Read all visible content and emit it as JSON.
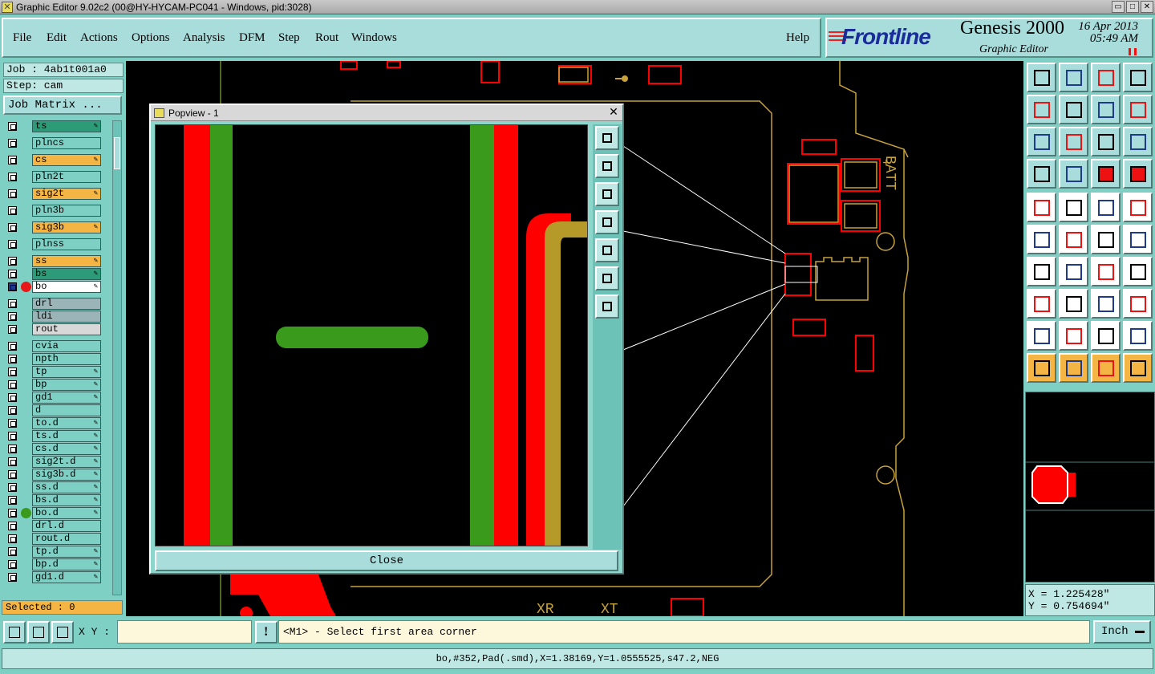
{
  "window": {
    "title": "Graphic Editor 9.02c2 (00@HY-HYCAM-PC041 - Windows, pid:3028)",
    "controls": [
      "restore-icon",
      "maximize-icon",
      "close-icon"
    ]
  },
  "menu": [
    {
      "label": "File"
    },
    {
      "label": "Edit"
    },
    {
      "label": "Actions"
    },
    {
      "label": "Options"
    },
    {
      "label": "Analysis"
    },
    {
      "label": "DFM"
    },
    {
      "label": "Step"
    },
    {
      "label": "Rout"
    },
    {
      "label": "Windows"
    },
    {
      "label": "Help"
    }
  ],
  "brand": {
    "logo": "Frontline",
    "product": "Genesis 2000",
    "subtitle": "Graphic Editor",
    "date": "16 Apr 2013",
    "time": "05:49 AM"
  },
  "job": {
    "job_label": "Job : 4ab1t001a0",
    "step_label": "Step: cam",
    "matrix_button": "Job Matrix ...",
    "selected": "Selected : 0"
  },
  "layers": [
    {
      "name": "ts",
      "color": "#2e9b78",
      "editable": true
    },
    {
      "name": "plncs",
      "color": "#7fd0c4",
      "editable": false
    },
    {
      "name": "cs",
      "color": "#f4b545",
      "editable": true
    },
    {
      "name": "pln2t",
      "color": "#7fd0c4",
      "editable": false
    },
    {
      "name": "sig2t",
      "color": "#f4b545",
      "editable": true
    },
    {
      "name": "pln3b",
      "color": "#7fd0c4",
      "editable": false
    },
    {
      "name": "sig3b",
      "color": "#f4b545",
      "editable": true
    },
    {
      "name": "plnss",
      "color": "#7fd0c4",
      "editable": false
    },
    {
      "name": "ss",
      "color": "#f4b545",
      "editable": true
    },
    {
      "name": "bs",
      "color": "#2e9b78",
      "editable": true
    },
    {
      "name": "bo",
      "color": "#ffffff",
      "editable": true,
      "dot": "#e81818",
      "active": true
    },
    {
      "name": "drl",
      "color": "#9ab4b8",
      "editable": false
    },
    {
      "name": "ldi",
      "color": "#9ab4b8",
      "editable": false
    },
    {
      "name": "rout",
      "color": "#d8d8d8",
      "editable": false
    },
    {
      "name": "cvia",
      "color": "#7fd0c4",
      "editable": false
    },
    {
      "name": "npth",
      "color": "#7fd0c4",
      "editable": false
    },
    {
      "name": "tp",
      "color": "#7fd0c4",
      "editable": true
    },
    {
      "name": "bp",
      "color": "#7fd0c4",
      "editable": true
    },
    {
      "name": "gd1",
      "color": "#7fd0c4",
      "editable": true
    },
    {
      "name": "d",
      "color": "#7fd0c4",
      "editable": false
    },
    {
      "name": "to.d",
      "color": "#7fd0c4",
      "editable": true
    },
    {
      "name": "ts.d",
      "color": "#7fd0c4",
      "editable": true
    },
    {
      "name": "cs.d",
      "color": "#7fd0c4",
      "editable": true
    },
    {
      "name": "sig2t.d",
      "color": "#7fd0c4",
      "editable": true
    },
    {
      "name": "sig3b.d",
      "color": "#7fd0c4",
      "editable": true
    },
    {
      "name": "ss.d",
      "color": "#7fd0c4",
      "editable": true
    },
    {
      "name": "bs.d",
      "color": "#7fd0c4",
      "editable": true
    },
    {
      "name": "bo.d",
      "color": "#7fd0c4",
      "editable": true,
      "dot": "#3a9a1c"
    },
    {
      "name": "drl.d",
      "color": "#7fd0c4",
      "editable": false
    },
    {
      "name": "rout.d",
      "color": "#7fd0c4",
      "editable": false
    },
    {
      "name": "tp.d",
      "color": "#7fd0c4",
      "editable": true
    },
    {
      "name": "bp.d",
      "color": "#7fd0c4",
      "editable": true
    },
    {
      "name": "gd1.d",
      "color": "#7fd0c4",
      "editable": true
    }
  ],
  "canvas_labels": {
    "label1": "XR",
    "label2": "XT",
    "label3": "BATT",
    "label4": "+"
  },
  "popview": {
    "title": "Popview - 1",
    "close_button": "Close",
    "tools": [
      "zoom-fit-icon",
      "pan-up-icon",
      "pan-down-icon",
      "pan-left-icon",
      "pan-right-icon",
      "zoom-in-icon",
      "zoom-out-icon"
    ]
  },
  "toolbox": [
    "home-up-icon",
    "home-down-icon",
    "home-icon",
    "window-icon",
    "pan-left-icon",
    "pan-right-icon",
    "undo-zoom-icon",
    "redraw-icon",
    "zoom-fit-icon",
    "zoom-center-icon",
    "scale-icon",
    "help-icon",
    "measure-tools-icon",
    "grid-icon",
    "layers-red-icon",
    "layers-blue-icon",
    "snap-pin-icon",
    "profile-icon",
    "ruler-icon",
    "pad-icon",
    "connect-icon",
    "cross-icon",
    "pen-icon",
    "pen-add-icon",
    "line-angle-icon",
    "line-icon",
    "arc-icon",
    "feature-icon",
    "pad-add-icon",
    "minus-icon",
    "dimension-icon",
    "circles-icon",
    "triangle-icon",
    "triangle-up-icon",
    "cone-icon",
    "cone-split-icon",
    "select-arrow-icon",
    "select-box-icon",
    "select-arrow-alt-icon",
    "net-icon"
  ],
  "coords": {
    "x": "X = 1.225428\"",
    "y": "Y = 0.754694\""
  },
  "bottom": {
    "xy_label": "X Y :",
    "xy_value": "",
    "prompt": "<M1> - Select first area corner",
    "units": "Inch",
    "status": "bo,#352,Pad(.smd),X=1.38169,Y=1.0555525,s47.2,NEG"
  },
  "colors": {
    "positive": "#ff0000",
    "negative": "#3a9a1c",
    "outline": "#c8a23a"
  }
}
